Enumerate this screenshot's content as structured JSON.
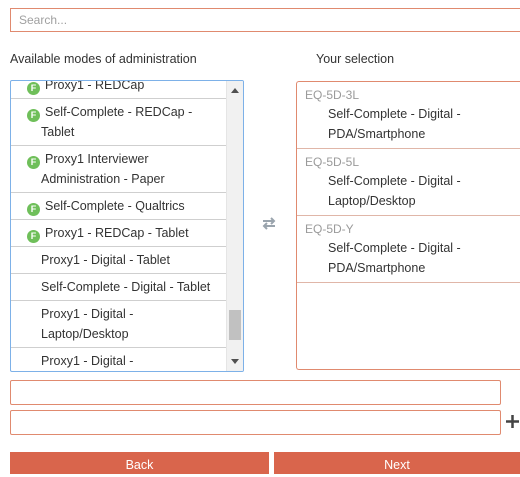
{
  "search": {
    "placeholder": "Search..."
  },
  "available": {
    "label": "Available modes of administration",
    "items": [
      {
        "text": "Proxy1 - REDCap",
        "flag": "F"
      },
      {
        "text": "Self-Complete - REDCap - Tablet",
        "flag": "F"
      },
      {
        "text": "Proxy1 Interviewer Administration - Paper",
        "flag": "F"
      },
      {
        "text": "Self-Complete - Qualtrics",
        "flag": "F"
      },
      {
        "text": "Proxy1 - REDCap - Tablet",
        "flag": "F"
      },
      {
        "text": "Proxy1 - Digital - Tablet",
        "flag": ""
      },
      {
        "text": "Self-Complete - Digital - Tablet",
        "flag": ""
      },
      {
        "text": "Proxy1 - Digital - Laptop/Desktop",
        "flag": ""
      },
      {
        "text": "Proxy1 - Digital -",
        "flag": ""
      }
    ]
  },
  "selection": {
    "label": "Your selection",
    "groups": [
      {
        "code": "EQ-5D-3L",
        "mode": "Self-Complete - Digital - PDA/Smartphone"
      },
      {
        "code": "EQ-5D-5L",
        "mode": "Self-Complete - Digital - Laptop/Desktop"
      },
      {
        "code": "EQ-5D-Y",
        "mode": "Self-Complete - Digital - PDA/Smartphone"
      }
    ]
  },
  "buttons": {
    "back": "Back",
    "next": "Next"
  },
  "colors": {
    "accent": "#d9654c",
    "border": "#e08a6f",
    "flag": "#6fbf5a",
    "list_border": "#7db1e8"
  },
  "icons": {
    "swap": "swap-arrows-icon",
    "add": "plus-icon",
    "flag": "flag-badge-icon"
  }
}
